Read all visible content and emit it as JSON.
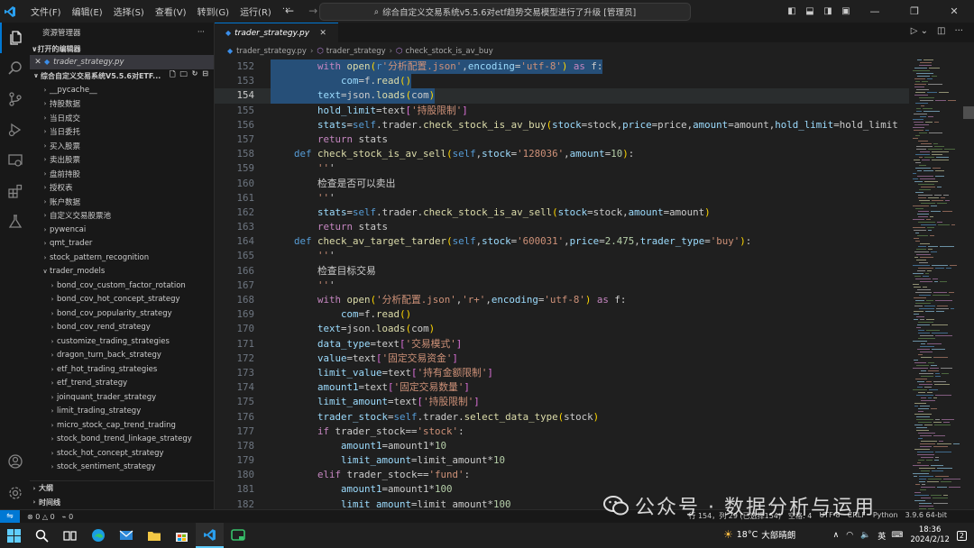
{
  "app": {
    "menu": [
      "文件(F)",
      "编辑(E)",
      "选择(S)",
      "查看(V)",
      "转到(G)",
      "运行(R)",
      "···"
    ],
    "command_center": "综合自定义交易系统v5.5.6对etf趋势交易模型进行了升级 [管理员]"
  },
  "sidebar": {
    "title": "资源管理器",
    "more": "···",
    "open_editors_label": "打开的编辑器",
    "open_editor_file": "trader_strategy.py",
    "project_label": "综合自定义交易系统V5.5.6对ETF...",
    "folders": [
      "__pycache__",
      "持股数据",
      "当日成交",
      "当日委托",
      "买入股票",
      "卖出股票",
      "盘前持股",
      "授权表",
      "账户数据",
      "自定义交易股票池",
      "pywencai",
      "qmt_trader",
      "stock_pattern_recognition"
    ],
    "open_folder": "trader_models",
    "subfolders": [
      "bond_cov_custom_factor_rotation",
      "bond_cov_hot_concept_strategy",
      "bond_cov_popularity_strategy",
      "bond_cov_rend_strategy",
      "customize_trading_strategies",
      "dragon_turn_back_strategy",
      "etf_hot_trading_strategies",
      "etf_trend_strategy",
      "joinquant_trader_strategy",
      "limit_trading_strategy",
      "micro_stock_cap_trend_trading",
      "stock_bond_trend_linkage_strategy",
      "stock_hot_concept_strategy",
      "stock_sentiment_strategy"
    ],
    "bottom_sections": [
      "大纲",
      "时间线"
    ]
  },
  "editor": {
    "tab_label": "trader_strategy.py",
    "breadcrumb": [
      "trader_strategy.py",
      "trader_strategy",
      "check_stock_is_av_buy"
    ],
    "current_line": 154,
    "lines": [
      {
        "n": 152,
        "text": "        with open(r'分析配置.json',encoding='utf-8') as f:"
      },
      {
        "n": 153,
        "text": "            com=f.read()"
      },
      {
        "n": 154,
        "text": "        text=json.loads(com)"
      },
      {
        "n": 155,
        "text": "        hold_limit=text['持股限制']"
      },
      {
        "n": 156,
        "text": "        stats=self.trader.check_stock_is_av_buy(stock=stock,price=price,amount=amount,hold_limit=hold_limit"
      },
      {
        "n": 157,
        "text": "        return stats"
      },
      {
        "n": 158,
        "text": "    def check_stock_is_av_sell(self,stock='128036',amount=10):"
      },
      {
        "n": 159,
        "text": "        '''"
      },
      {
        "n": 160,
        "text": "        检查是否可以卖出"
      },
      {
        "n": 161,
        "text": "        '''"
      },
      {
        "n": 162,
        "text": "        stats=self.trader.check_stock_is_av_sell(stock=stock,amount=amount)"
      },
      {
        "n": 163,
        "text": "        return stats"
      },
      {
        "n": 164,
        "text": "    def check_av_target_tarder(self,stock='600031',price=2.475,trader_type='buy'):"
      },
      {
        "n": 165,
        "text": "        '''"
      },
      {
        "n": 166,
        "text": "        检查目标交易"
      },
      {
        "n": 167,
        "text": "        '''"
      },
      {
        "n": 168,
        "text": "        with open('分析配置.json','r+',encoding='utf-8') as f:"
      },
      {
        "n": 169,
        "text": "            com=f.read()"
      },
      {
        "n": 170,
        "text": "        text=json.loads(com)"
      },
      {
        "n": 171,
        "text": "        data_type=text['交易模式']"
      },
      {
        "n": 172,
        "text": "        value=text['固定交易资金']"
      },
      {
        "n": 173,
        "text": "        limit_value=text['持有金额限制']"
      },
      {
        "n": 174,
        "text": "        amount1=text['固定交易数量']"
      },
      {
        "n": 175,
        "text": "        limit_amount=text['持股限制']"
      },
      {
        "n": 176,
        "text": "        trader_stock=self.trader.select_data_type(stock)"
      },
      {
        "n": 177,
        "text": "        if trader_stock=='stock':"
      },
      {
        "n": 178,
        "text": "            amount1=amount1*10"
      },
      {
        "n": 179,
        "text": "            limit_amount=limit_amount*10"
      },
      {
        "n": 180,
        "text": "        elif trader_stock=='fund':"
      },
      {
        "n": 181,
        "text": "            amount1=amount1*100"
      },
      {
        "n": 182,
        "text": "            limit_amount=limit_amount*100"
      }
    ]
  },
  "statusbar": {
    "errors": "0",
    "warnings": "0",
    "ports": "0",
    "position": "行 154，列 29 (已选择154)",
    "spaces": "空格: 4",
    "encoding": "UTF-8",
    "eol": "CRLF",
    "language": "Python",
    "interpreter": "3.9.6 64-bit"
  },
  "taskbar": {
    "weather_temp": "18°C",
    "weather_desc": "大部晴朗",
    "ime": "英",
    "time": "18:36",
    "date": "2024/2/12",
    "notifications": "2"
  },
  "watermark": "公众号 · 数据分析与运用",
  "colors": {
    "accent": "#0078d4",
    "keyword": "#c586c0",
    "string": "#ce9178",
    "function": "#dcdcaa"
  }
}
